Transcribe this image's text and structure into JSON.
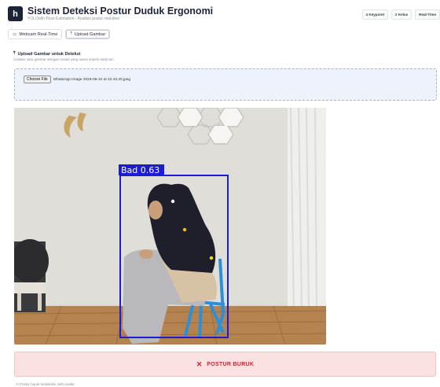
{
  "app": {
    "logo_letter": "h",
    "title": "Sistem Deteksi Postur Duduk Ergonomi",
    "subtitle": "YOLOv8n Pose Estimation · Analisis postur real-time"
  },
  "badges": [
    "4 Keypoint",
    "2 Kelas",
    "Real-Time"
  ],
  "tabs": [
    {
      "label": "Webcam Real-Time",
      "icon": "camera-icon",
      "glyph": "▭"
    },
    {
      "label": "Upload Gambar",
      "icon": "upload-icon",
      "glyph": "⤒"
    }
  ],
  "upload": {
    "title": "Upload Gambar untuk Deteksi",
    "title_glyph": "⤒",
    "description": "Analisis satu gambar dengan model yang sama seperti webcam"
  },
  "file_input": {
    "button_label": "Choose File",
    "file_name": "WhatsApp Image 2026-06-10 at 22.43.20.jpeg"
  },
  "detection": {
    "label": "Bad  0.63",
    "box_color": "#1c1cd4",
    "keypoint_colors": [
      "#ffffff",
      "#f2c500",
      "#f2e600"
    ]
  },
  "result": {
    "icon": "close-icon",
    "glyph": "✕",
    "text": "POSTUR BURUK",
    "color": "#c62828",
    "background": "#fbe1e1"
  },
  "footnote": "⊙ Postur buruk terdeteksi oleh model"
}
